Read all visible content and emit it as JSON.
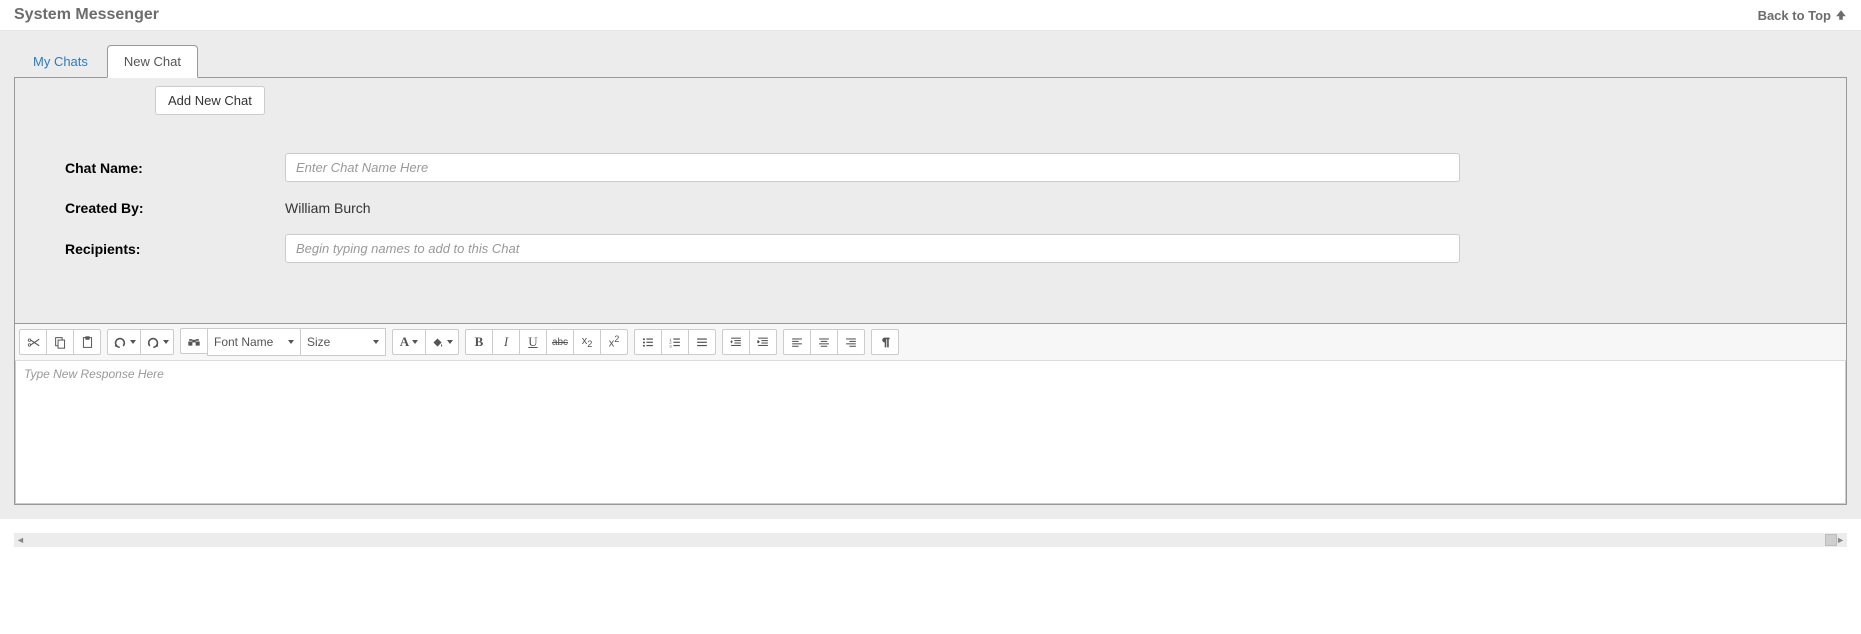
{
  "header": {
    "title": "System Messenger",
    "back_to_top": "Back to Top"
  },
  "tabs": {
    "my_chats": "My Chats",
    "new_chat": "New Chat"
  },
  "buttons": {
    "add_new_chat": "Add New Chat"
  },
  "form": {
    "chat_name_label": "Chat Name:",
    "chat_name_placeholder": "Enter Chat Name Here",
    "created_by_label": "Created By:",
    "created_by_value": "William Burch",
    "recipients_label": "Recipients:",
    "recipients_placeholder": "Begin typing names to add to this Chat"
  },
  "editor": {
    "font_name_label": "Font Name",
    "size_label": "Size",
    "placeholder": "Type New Response Here",
    "font_color_letter": "A",
    "sub_label": "x",
    "sup_label": "x",
    "strike_label": "abc"
  }
}
